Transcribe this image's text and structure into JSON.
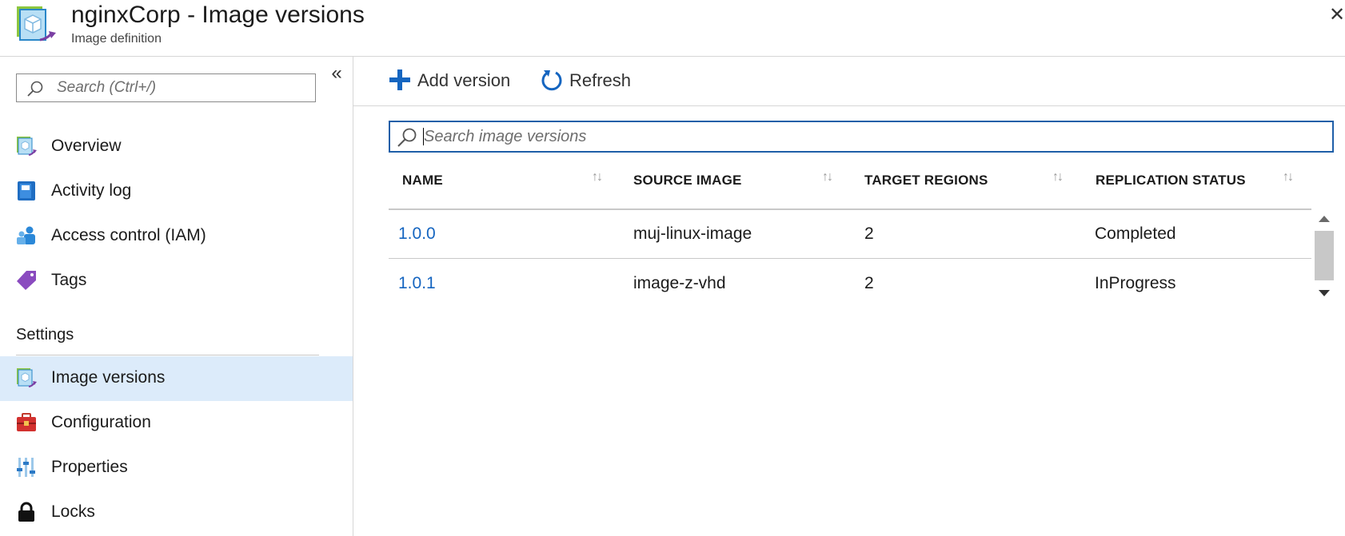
{
  "header": {
    "title": "nginxCorp - Image versions",
    "subtitle": "Image definition",
    "close_icon": "close-icon",
    "app_icon": "image-definition-icon"
  },
  "sidebar": {
    "search": {
      "placeholder": "Search (Ctrl+/)",
      "value": ""
    },
    "collapse_label": "«",
    "items": [
      {
        "label": "Overview",
        "icon": "image-definition-icon"
      },
      {
        "label": "Activity log",
        "icon": "activity-log-icon"
      },
      {
        "label": "Access control (IAM)",
        "icon": "access-control-icon"
      },
      {
        "label": "Tags",
        "icon": "tag-icon"
      }
    ],
    "settings_header": "Settings",
    "settings_items": [
      {
        "label": "Image versions",
        "icon": "image-versions-icon",
        "selected": true
      },
      {
        "label": "Configuration",
        "icon": "toolbox-icon"
      },
      {
        "label": "Properties",
        "icon": "properties-icon"
      },
      {
        "label": "Locks",
        "icon": "lock-icon"
      }
    ]
  },
  "toolbar": {
    "add_label": "Add version",
    "refresh_label": "Refresh"
  },
  "search": {
    "placeholder": "Search image versions",
    "value": ""
  },
  "table": {
    "columns": [
      "NAME",
      "SOURCE IMAGE",
      "TARGET REGIONS",
      "REPLICATION STATUS"
    ],
    "rows": [
      {
        "name": "1.0.0",
        "source_image": "muj-linux-image",
        "target_regions": "2",
        "replication_status": "Completed"
      },
      {
        "name": "1.0.1",
        "source_image": "image-z-vhd",
        "target_regions": "2",
        "replication_status": "InProgress"
      }
    ]
  },
  "colors": {
    "accent": "#1565c0",
    "selected_bg": "#dcebfa",
    "search_border": "#1f5fa8"
  }
}
